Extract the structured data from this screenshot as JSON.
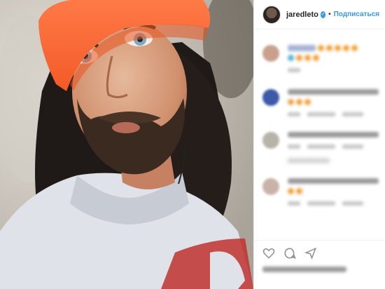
{
  "post": {
    "username": "jaredleto",
    "verified_icon": "verified-badge-icon",
    "separator": "•",
    "follow_label": "Подписаться"
  },
  "colors": {
    "beanie": "#ff6a35",
    "hoodie": "#dfe2e8",
    "accent": "#3897f0",
    "hoodie_text": "#c0312e"
  },
  "icons": [
    "verified-badge-icon",
    "heart-icon",
    "comment-icon",
    "share-icon"
  ]
}
